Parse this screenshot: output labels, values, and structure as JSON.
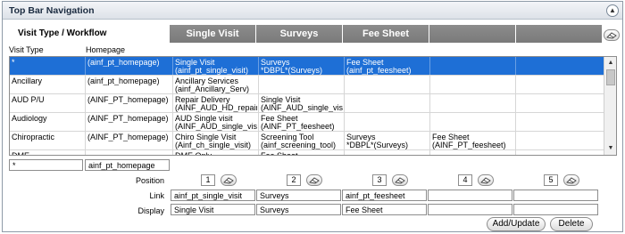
{
  "panel": {
    "title": "Top Bar Navigation",
    "collapse_icon": "chevron-up-icon"
  },
  "section_label": "Visit Type / Workflow",
  "column_headers": [
    "Single Visit",
    "Surveys",
    "Fee Sheet",
    "",
    ""
  ],
  "labels": {
    "visit_type": "Visit Type",
    "homepage": "Homepage"
  },
  "rows": [
    {
      "visit_type": "*",
      "homepage": "(ainf_pt_homepage)",
      "cols": [
        "Single Visit\n(ainf_pt_single_visit)",
        "Surveys\n*DBPL*(Surveys)",
        "Fee Sheet\n(ainf_pt_feesheet)",
        "",
        ""
      ]
    },
    {
      "visit_type": "Ancillary",
      "homepage": "(ainf_pt_homepage)",
      "cols": [
        "Ancillary Services\n(ainf_Ancillary_Serv)",
        "",
        "",
        "",
        ""
      ]
    },
    {
      "visit_type": "AUD P/U",
      "homepage": "(AINF_PT_homepage)",
      "cols": [
        "Repair Delivery\n(AINF_AUD_HD_repair_d",
        "Single Visit\n(AINF_AUD_single_visit)",
        "",
        "",
        ""
      ]
    },
    {
      "visit_type": "Audiology",
      "homepage": "(AINF_PT_homepage)",
      "cols": [
        "AUD Single visit\n(AINF_AUD_single_visit)",
        "Fee Sheet\n(AINF_PT_feesheet)",
        "",
        "",
        ""
      ]
    },
    {
      "visit_type": "Chiropractic",
      "homepage": "(AINF_PT_homepage)",
      "cols": [
        "Chiro Single Visit\n(Ainf_ch_single_visit)",
        "Screening Tool\n(ainf_screening_tool)",
        "Surveys\n*DBPL*(Surveys)",
        "Fee Sheet\n(AINF_PT_feesheet)",
        ""
      ]
    },
    {
      "visit_type": "DME",
      "homepage": "",
      "cols": [
        "DME Only",
        "Fee Sheet",
        "",
        "",
        ""
      ]
    }
  ],
  "editor": {
    "visit_type_value": "*",
    "homepage_value": "ainf_pt_homepage",
    "position_label": "Position",
    "link_label": "Link",
    "display_label": "Display",
    "positions": [
      "1",
      "2",
      "3",
      "4",
      "5"
    ],
    "links": [
      "ainf_pt_single_visit",
      "Surveys",
      "ainf_pt_feesheet",
      "",
      ""
    ],
    "displays": [
      "Single Visit",
      "Surveys",
      "Fee Sheet",
      "",
      ""
    ]
  },
  "buttons": {
    "add_update": "Add/Update",
    "delete": "Delete"
  },
  "colors": {
    "selected_row": "#1e6fd6",
    "column_header": "#808080"
  },
  "icons": {
    "erase": "eraser-icon",
    "scroll_up": "scroll-up-arrow-icon",
    "scroll_down": "scroll-down-arrow-icon"
  }
}
